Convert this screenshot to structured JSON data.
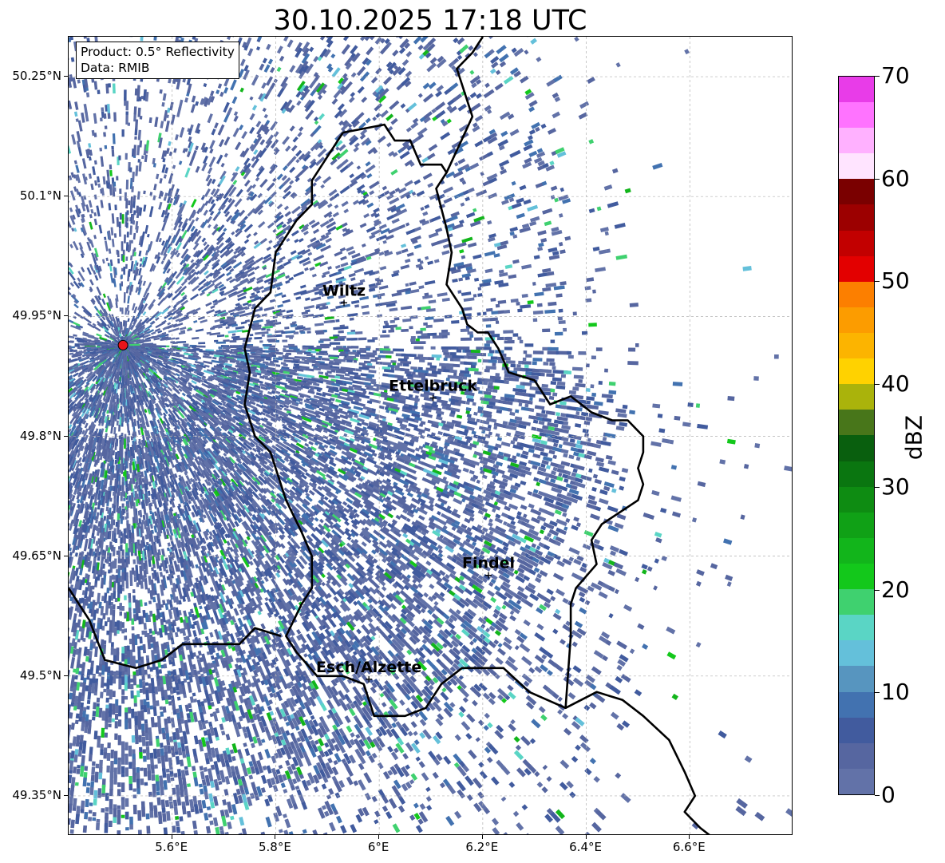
{
  "title": "30.10.2025 17:18 UTC",
  "info_box": {
    "product": "Product: 0.5° Reflectivity",
    "data": "Data: RMIB"
  },
  "map": {
    "lon_range": [
      5.4,
      6.8
    ],
    "lat_range": [
      49.3,
      50.3
    ],
    "radar_site": {
      "lon": 5.505,
      "lat": 49.914,
      "color": "#e8141a"
    },
    "x_ticks": [
      {
        "lon": 5.6,
        "label": "5.6°E"
      },
      {
        "lon": 5.8,
        "label": "5.8°E"
      },
      {
        "lon": 6.0,
        "label": "6°E"
      },
      {
        "lon": 6.2,
        "label": "6.2°E"
      },
      {
        "lon": 6.4,
        "label": "6.4°E"
      },
      {
        "lon": 6.6,
        "label": "6.6°E"
      }
    ],
    "y_ticks": [
      {
        "lat": 50.25,
        "label": "50.25°N"
      },
      {
        "lat": 50.1,
        "label": "50.1°N"
      },
      {
        "lat": 49.95,
        "label": "49.95°N"
      },
      {
        "lat": 49.8,
        "label": "49.8°N"
      },
      {
        "lat": 49.65,
        "label": "49.65°N"
      },
      {
        "lat": 49.5,
        "label": "49.5°N"
      },
      {
        "lat": 49.35,
        "label": "49.35°N"
      }
    ],
    "cities": [
      {
        "name": "Wiltz",
        "lon": 5.932,
        "lat": 49.967
      },
      {
        "name": "Ettelbruck",
        "lon": 6.104,
        "lat": 49.848
      },
      {
        "name": "Findel",
        "lon": 6.211,
        "lat": 49.626
      },
      {
        "name": "Esch/Alzette",
        "lon": 5.98,
        "lat": 49.496
      }
    ],
    "border_lu_west": [
      [
        5.93,
        50.18
      ],
      [
        6.01,
        50.19
      ],
      [
        6.03,
        50.17
      ],
      [
        6.06,
        50.17
      ],
      [
        6.08,
        50.14
      ],
      [
        6.12,
        50.14
      ],
      [
        6.13,
        50.13
      ],
      [
        6.11,
        50.11
      ],
      [
        6.13,
        50.06
      ],
      [
        6.14,
        50.03
      ],
      [
        6.13,
        49.99
      ],
      [
        6.16,
        49.96
      ],
      [
        6.17,
        49.94
      ],
      [
        6.19,
        49.93
      ],
      [
        6.21,
        49.93
      ],
      [
        6.23,
        49.91
      ],
      [
        6.25,
        49.88
      ],
      [
        6.3,
        49.87
      ],
      [
        6.33,
        49.84
      ],
      [
        6.37,
        49.85
      ],
      [
        6.41,
        49.83
      ],
      [
        6.45,
        49.82
      ],
      [
        6.48,
        49.82
      ],
      [
        6.51,
        49.8
      ],
      [
        6.51,
        49.78
      ],
      [
        6.5,
        49.76
      ],
      [
        6.51,
        49.74
      ],
      [
        6.5,
        49.72
      ],
      [
        6.43,
        49.69
      ],
      [
        6.41,
        49.67
      ],
      [
        6.42,
        49.64
      ],
      [
        6.38,
        49.61
      ],
      [
        6.37,
        49.59
      ],
      [
        6.37,
        49.55
      ],
      [
        6.36,
        49.46
      ],
      [
        6.29,
        49.48
      ],
      [
        6.24,
        49.51
      ],
      [
        6.16,
        49.51
      ],
      [
        6.12,
        49.49
      ],
      [
        6.09,
        49.46
      ],
      [
        6.05,
        49.45
      ],
      [
        6.02,
        49.45
      ],
      [
        5.99,
        49.45
      ],
      [
        5.97,
        49.49
      ],
      [
        5.93,
        49.5
      ],
      [
        5.88,
        49.5
      ],
      [
        5.84,
        49.53
      ],
      [
        5.82,
        49.55
      ],
      [
        5.85,
        49.59
      ],
      [
        5.87,
        49.61
      ],
      [
        5.87,
        49.65
      ],
      [
        5.85,
        49.68
      ],
      [
        5.82,
        49.72
      ],
      [
        5.79,
        49.78
      ],
      [
        5.76,
        49.8
      ],
      [
        5.74,
        49.84
      ],
      [
        5.75,
        49.88
      ],
      [
        5.74,
        49.91
      ],
      [
        5.76,
        49.96
      ],
      [
        5.79,
        49.98
      ],
      [
        5.8,
        50.03
      ],
      [
        5.84,
        50.07
      ],
      [
        5.87,
        50.09
      ],
      [
        5.87,
        50.12
      ],
      [
        5.93,
        50.18
      ]
    ],
    "border_be_fr": [
      [
        5.4,
        49.61
      ],
      [
        5.44,
        49.57
      ],
      [
        5.47,
        49.52
      ],
      [
        5.53,
        49.51
      ],
      [
        5.58,
        49.52
      ],
      [
        5.62,
        49.54
      ],
      [
        5.69,
        49.54
      ],
      [
        5.73,
        49.54
      ],
      [
        5.76,
        49.56
      ],
      [
        5.81,
        49.55
      ]
    ],
    "border_de_be": [
      [
        6.13,
        50.13
      ],
      [
        6.18,
        50.2
      ],
      [
        6.15,
        50.26
      ],
      [
        6.18,
        50.28
      ],
      [
        6.2,
        50.3
      ]
    ],
    "border_de_fr": [
      [
        6.36,
        49.46
      ],
      [
        6.42,
        49.48
      ],
      [
        6.47,
        49.47
      ],
      [
        6.51,
        49.45
      ],
      [
        6.56,
        49.42
      ],
      [
        6.59,
        49.38
      ],
      [
        6.61,
        49.35
      ],
      [
        6.59,
        49.33
      ],
      [
        6.62,
        49.31
      ],
      [
        6.64,
        49.3
      ]
    ]
  },
  "colorbar": {
    "label": "dBZ",
    "min": 0,
    "max": 70,
    "ticks": [
      0,
      10,
      20,
      30,
      40,
      50,
      60,
      70
    ],
    "colors": [
      "#6272a8",
      "#5666a0",
      "#415b9e",
      "#4272b0",
      "#5795bf",
      "#64c0da",
      "#5ad5c5",
      "#3fd16f",
      "#13c81b",
      "#12b51b",
      "#10a116",
      "#0e8c12",
      "#0a7610",
      "#095f0e",
      "#48761a",
      "#aab30b",
      "#ffd200",
      "#fcb400",
      "#fc9c00",
      "#fc7f00",
      "#e30000",
      "#c20000",
      "#9c0000",
      "#7a0000",
      "#ffe4ff",
      "#ffb1ff",
      "#ff73ff",
      "#e83ce8"
    ]
  }
}
